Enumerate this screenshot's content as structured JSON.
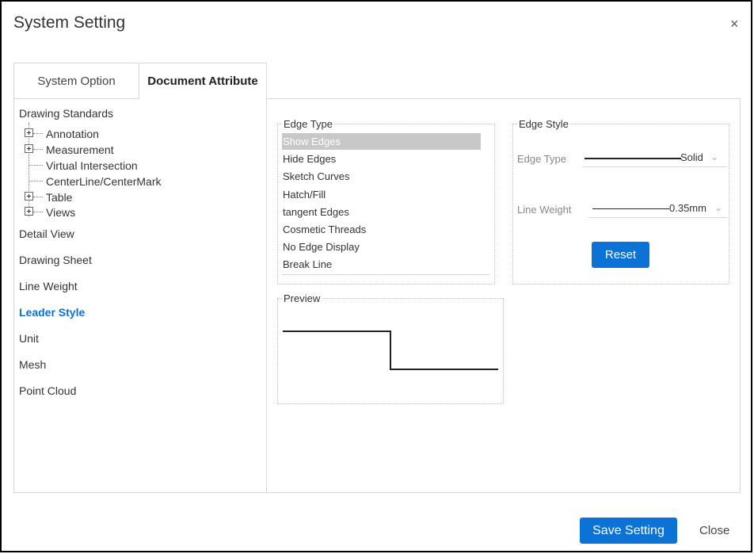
{
  "dialog": {
    "title": "System Setting",
    "close_glyph": "×"
  },
  "tabs": [
    {
      "label": "System Option"
    },
    {
      "label": "Document Attribute"
    }
  ],
  "nav": {
    "drawing_standards": "Drawing Standards",
    "tree": [
      {
        "label": "Annotation",
        "expandable": true
      },
      {
        "label": "Measurement",
        "expandable": true
      },
      {
        "label": "Virtual Intersection",
        "expandable": false
      },
      {
        "label": "CenterLine/CenterMark",
        "expandable": false
      },
      {
        "label": "Table",
        "expandable": true
      },
      {
        "label": "Views",
        "expandable": true
      }
    ],
    "items": [
      {
        "label": "Detail View"
      },
      {
        "label": "Drawing Sheet"
      },
      {
        "label": "Line Weight"
      },
      {
        "label": "Leader Style"
      },
      {
        "label": "Unit"
      },
      {
        "label": "Mesh"
      },
      {
        "label": "Point Cloud"
      }
    ],
    "active": "Leader Style"
  },
  "edge_type": {
    "legend": "Edge Type",
    "options": [
      "Show Edges",
      "Hide Edges",
      "Sketch Curves",
      "Hatch/Fill",
      "tangent Edges",
      "Cosmetic Threads",
      "No Edge Display",
      "Break Line"
    ],
    "selected": "Show Edges"
  },
  "edge_style": {
    "legend": "Edge Style",
    "edge_type_label": "Edge Type",
    "edge_type_value": "Solid",
    "line_weight_label": "Line Weight",
    "line_weight_value": "0.35mm",
    "reset_label": "Reset"
  },
  "preview": {
    "legend": "Preview"
  },
  "footer": {
    "save_label": "Save Setting",
    "close_label": "Close"
  },
  "colors": {
    "accent": "#0b72d6",
    "selection": "#c8c8c8"
  }
}
